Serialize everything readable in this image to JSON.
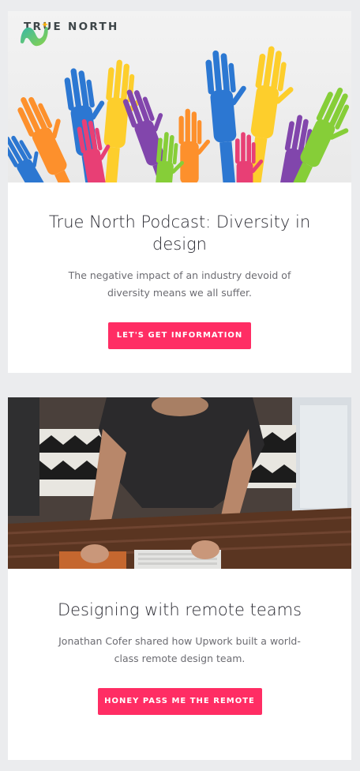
{
  "brand": {
    "name": "TRUE NORTH",
    "accent": "#ff2d64"
  },
  "cards": [
    {
      "image": "raised-colorful-hands",
      "title": "True North Podcast: Diversity in design",
      "description": "The negative impact of an industry devoid of diversity means we all suffer.",
      "button_label": "LET'S GET INFORMATION"
    },
    {
      "image": "person-typing-at-desk",
      "title": "Designing with remote teams",
      "description": "Jonathan Cofer shared how Upwork built a world-class remote design team.",
      "button_label": "HONEY PASS ME THE REMOTE"
    }
  ]
}
